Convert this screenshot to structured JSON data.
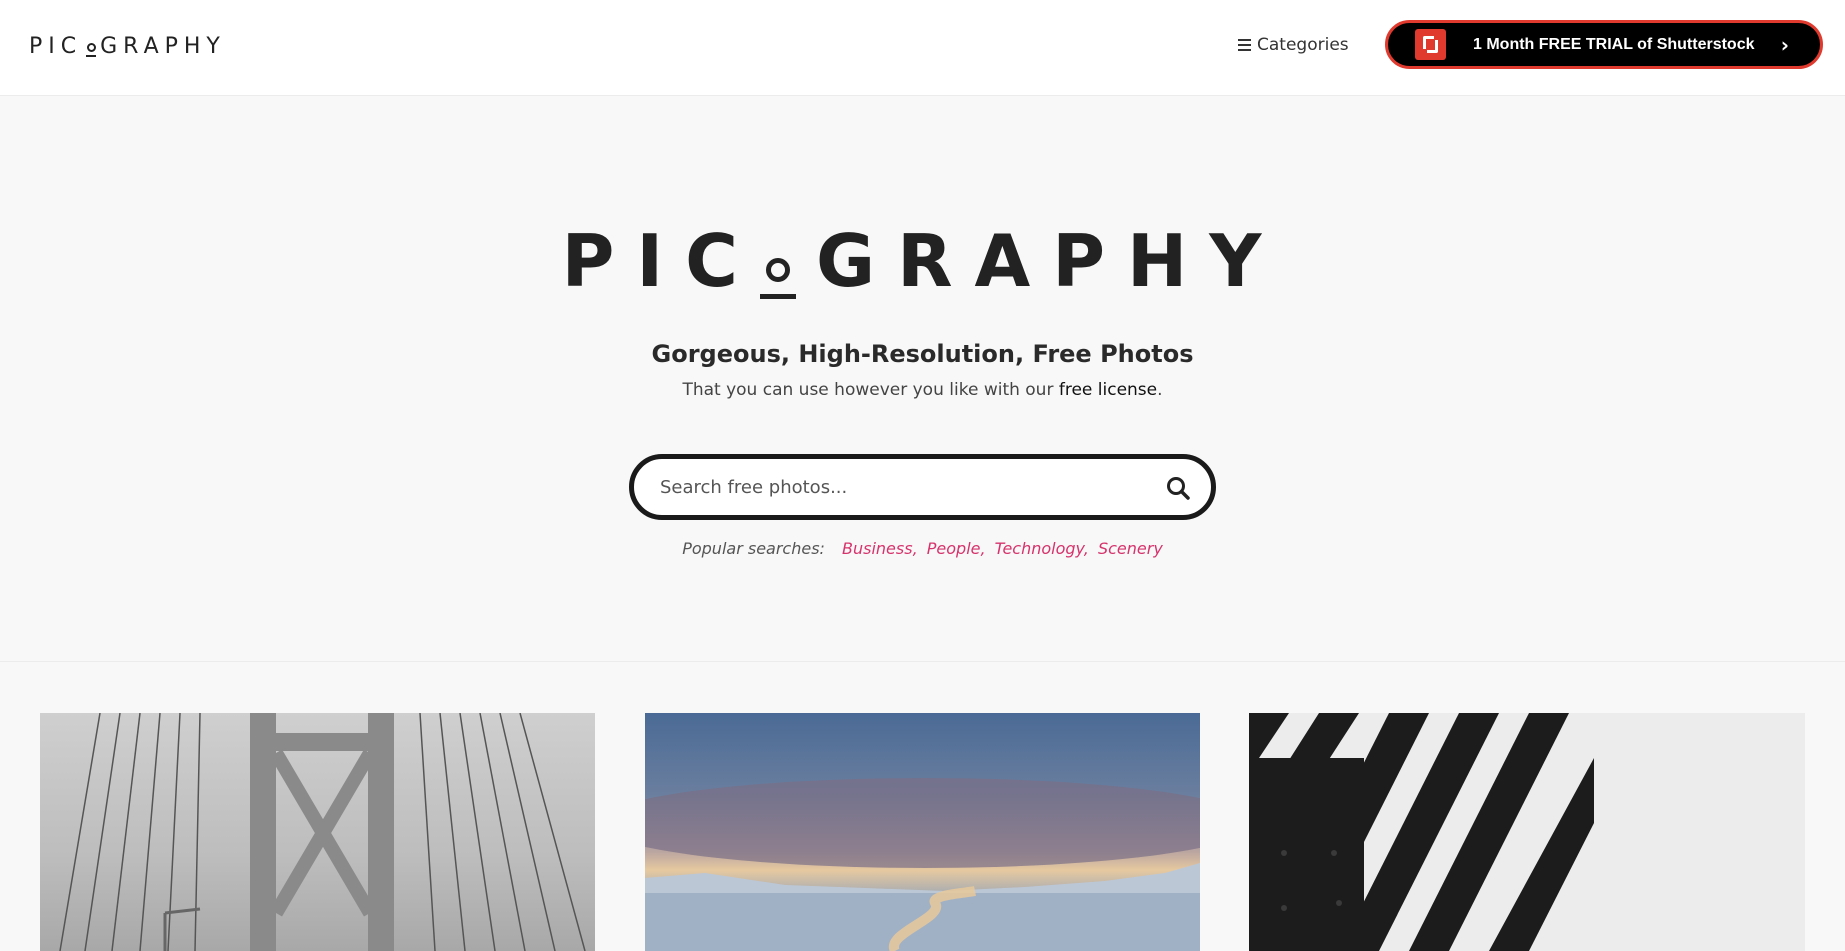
{
  "header": {
    "logo": "PICOGRAPHY",
    "categories_label": "Categories",
    "trial_label": "1 Month FREE TRIAL of Shutterstock",
    "trial_chevron": "›"
  },
  "hero": {
    "logo": "PICOGRAPHY",
    "tagline": "Gorgeous, High-Resolution, Free Photos",
    "subline_prefix": "That you can use however you like with our ",
    "subline_link": "free license",
    "subline_suffix": ".",
    "search_placeholder": "Search free photos...",
    "popular_label": "Popular searches:",
    "popular_tags": [
      "Business,",
      "People,",
      "Technology,",
      "Scenery"
    ]
  },
  "colors": {
    "accent_pink": "#d6336c",
    "trial_border": "#e03a2e",
    "page_bg": "#f8f8f8"
  },
  "icons": [
    "menu-icon",
    "shutterstock-logo-icon",
    "chevron-right-icon",
    "search-icon"
  ],
  "photos": [
    "bridge-photo",
    "landscape-photo",
    "stripes-photo"
  ]
}
